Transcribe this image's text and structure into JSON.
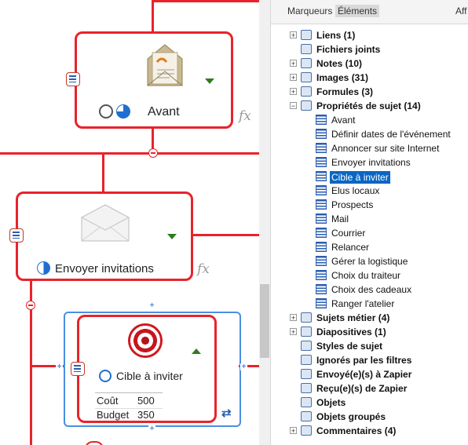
{
  "map": {
    "topics": [
      {
        "label": "Avant"
      },
      {
        "label": "Envoyer invitations"
      },
      {
        "label": "Cible à inviter"
      }
    ],
    "properties": [
      {
        "name": "Coût",
        "value": "500"
      },
      {
        "name": "Budget",
        "value": "350"
      }
    ],
    "fx_label": "fx"
  },
  "panel": {
    "tabs": [
      "Marqueurs",
      "Éléments",
      "Aff"
    ],
    "active_tab": "Éléments",
    "tree": [
      {
        "label": "Liens (1)",
        "bold": true,
        "expander": "+",
        "icon": "link-icon"
      },
      {
        "label": "Fichiers joints",
        "bold": true,
        "expander": "",
        "icon": "paperclip-icon"
      },
      {
        "label": "Notes (10)",
        "bold": true,
        "expander": "+",
        "icon": "notes-icon"
      },
      {
        "label": "Images (31)",
        "bold": true,
        "expander": "+",
        "icon": "image-icon"
      },
      {
        "label": "Formules (3)",
        "bold": true,
        "expander": "+",
        "icon": "formula-icon"
      },
      {
        "label": "Propriétés de sujet (14)",
        "bold": true,
        "expander": "−",
        "icon": "properties-icon"
      },
      {
        "label": "Avant",
        "bold": false,
        "child": true
      },
      {
        "label": "Définir dates de l'événement",
        "bold": false,
        "child": true
      },
      {
        "label": "Annoncer sur site Internet",
        "bold": false,
        "child": true
      },
      {
        "label": "Envoyer invitations",
        "bold": false,
        "child": true
      },
      {
        "label": "Cible à inviter",
        "bold": false,
        "child": true,
        "selected": true
      },
      {
        "label": "Elus locaux",
        "bold": false,
        "child": true
      },
      {
        "label": "Prospects",
        "bold": false,
        "child": true
      },
      {
        "label": "Mail",
        "bold": false,
        "child": true
      },
      {
        "label": "Courrier",
        "bold": false,
        "child": true
      },
      {
        "label": "Relancer",
        "bold": false,
        "child": true
      },
      {
        "label": "Gérer la logistique",
        "bold": false,
        "child": true
      },
      {
        "label": "Choix du traiteur",
        "bold": false,
        "child": true
      },
      {
        "label": "Choix des cadeaux",
        "bold": false,
        "child": true
      },
      {
        "label": "Ranger l'atelier",
        "bold": false,
        "child": true
      },
      {
        "label": "Sujets métier (4)",
        "bold": true,
        "expander": "+",
        "icon": "business-topic-icon"
      },
      {
        "label": "Diapositives (1)",
        "bold": true,
        "expander": "+",
        "icon": "slides-icon"
      },
      {
        "label": "Styles de sujet",
        "bold": true,
        "expander": "",
        "icon": "topic-style-icon"
      },
      {
        "label": "Ignorés par les filtres",
        "bold": true,
        "expander": "",
        "icon": "filter-icon"
      },
      {
        "label": "Envoyé(e)(s) à Zapier",
        "bold": true,
        "expander": "",
        "icon": "zapier-sent-icon"
      },
      {
        "label": "Reçu(e)(s) de Zapier",
        "bold": true,
        "expander": "",
        "icon": "zapier-received-icon"
      },
      {
        "label": "Objets",
        "bold": true,
        "expander": "",
        "icon": "object-icon"
      },
      {
        "label": "Objets groupés",
        "bold": true,
        "expander": "",
        "icon": "grouped-objects-icon"
      },
      {
        "label": "Commentaires (4)",
        "bold": true,
        "expander": "+",
        "icon": "comments-icon"
      }
    ]
  }
}
